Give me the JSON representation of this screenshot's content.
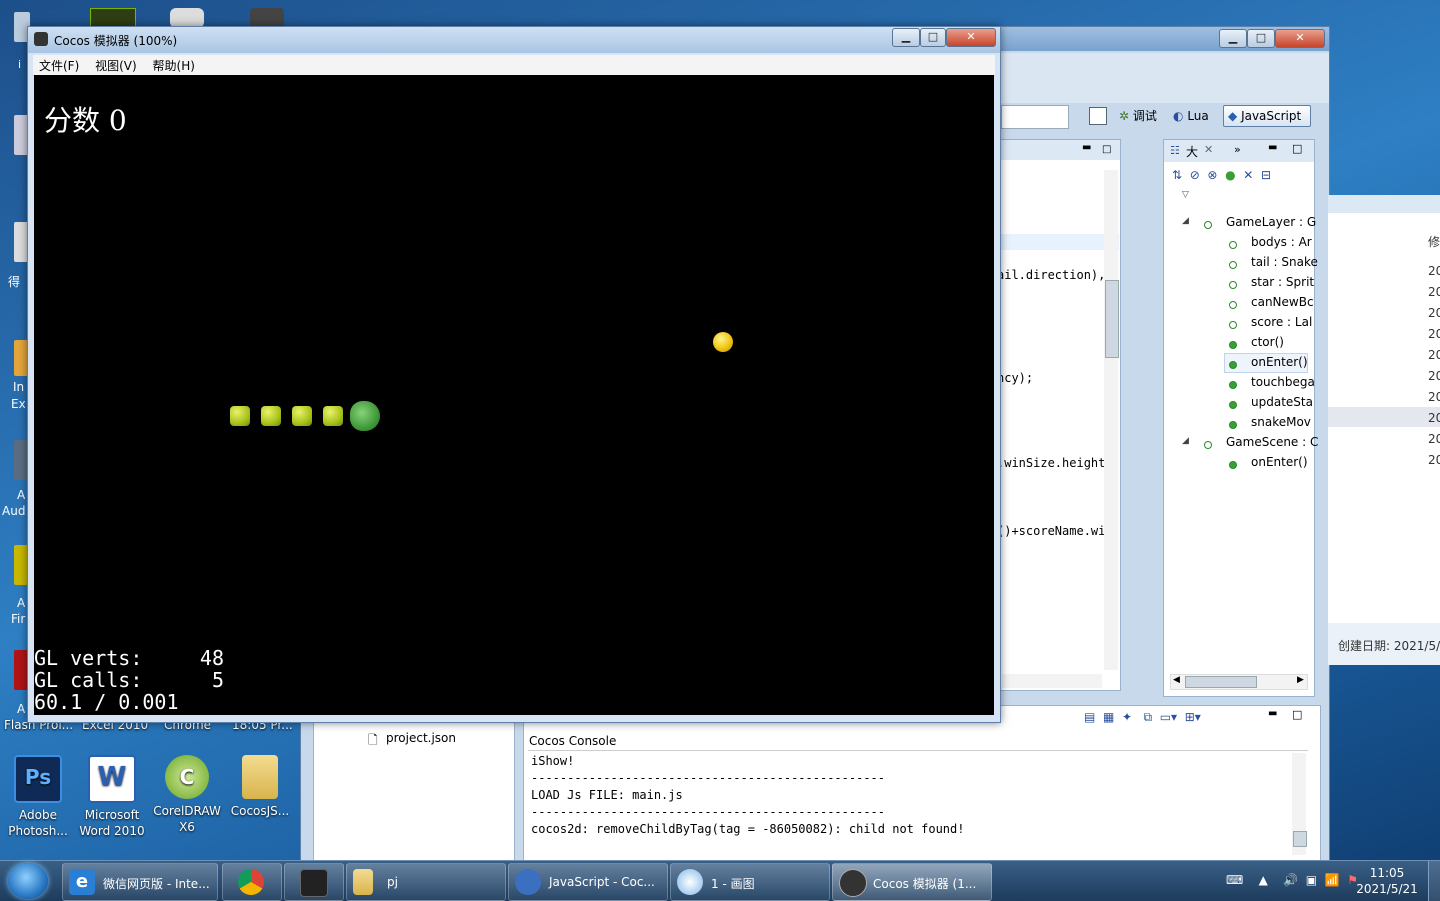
{
  "desktop": {
    "icons": [
      {
        "label": "Adobe Photosh...",
        "color": "#1f4f9c",
        "glyph": "Ps"
      },
      {
        "label": "Microsoft Word 2010",
        "color": "#2b5fb0",
        "glyph": "W"
      },
      {
        "label": "CorelDRAW X6",
        "color": "#6aa520",
        "glyph": "C"
      },
      {
        "label": "CocosJS...",
        "color": "#e2c56a",
        "glyph": ""
      }
    ],
    "partial_labels": [
      "Flash Prof...",
      "Excel 2010",
      "Chrome",
      "18:05 Pr..."
    ],
    "left_edge_labels": [
      "i",
      "得",
      "In",
      "Ex",
      "A",
      "Aud",
      "A",
      "Fir",
      "A"
    ]
  },
  "simulator": {
    "title": "Cocos 模拟器 (100%)",
    "menu": [
      "文件(F)",
      "视图(V)",
      "帮助(H)"
    ],
    "score_label": "分数 0",
    "stats": {
      "verts_label": "GL verts:",
      "verts_value": "48",
      "calls_label": "GL calls:",
      "calls_value": "5",
      "fps": "60.1 / 0.001"
    }
  },
  "ide": {
    "perspectives": {
      "debug": "调试",
      "lua": "Lua",
      "javascript": "JavaScript"
    },
    "code_fragments": [
      "ail.direction),",
      "ncy);",
      ".winSize.height",
      "()+scoreName.wi"
    ],
    "outline": {
      "tab_label": "大",
      "items": [
        {
          "label": "GameLayer : G",
          "level": 0
        },
        {
          "label": "bodys : Ar",
          "level": 1
        },
        {
          "label": "tail : Snake",
          "level": 1
        },
        {
          "label": "star : Sprit",
          "level": 1
        },
        {
          "label": "canNewBc",
          "level": 1
        },
        {
          "label": "score : Lal",
          "level": 1
        },
        {
          "label": "ctor()",
          "level": 1
        },
        {
          "label": "onEnter()",
          "level": 1
        },
        {
          "label": "touchbega",
          "level": 1
        },
        {
          "label": "updateSta",
          "level": 1
        },
        {
          "label": "snakeMov",
          "level": 1
        },
        {
          "label": "GameScene : C",
          "level": 0
        },
        {
          "label": "onEnter()",
          "level": 1
        }
      ]
    },
    "right_panel": {
      "header": "修",
      "rows": [
        "20",
        "20",
        "20",
        "20",
        "20",
        "20",
        "20",
        "20",
        "20",
        "20"
      ],
      "created": "创建日期: 2021/5/"
    },
    "project_file": "project.json",
    "console": {
      "title": "Cocos Console",
      "lines": [
        "iShow!",
        "-------------------------------------------------",
        "LOAD Js FILE: main.js",
        "-------------------------------------------------",
        "cocos2d: removeChildByTag(tag = -86050082): child not found!"
      ]
    }
  },
  "taskbar": {
    "items": [
      {
        "label": "微信网页版 - Inte...",
        "color": "#2a7fd4"
      },
      {
        "label": "",
        "color": "#db4437"
      },
      {
        "label": "",
        "color": "#222222"
      },
      {
        "label": "pj",
        "color": "#e8c766"
      },
      {
        "label": "JavaScript - Coc...",
        "color": "#3b6fc0"
      },
      {
        "label": "1 - 画图",
        "color": "#7fb7e8"
      },
      {
        "label": "Cocos 模拟器 (1...",
        "color": "#333333"
      }
    ],
    "clock_time": "11:05",
    "clock_date": "2021/5/21"
  }
}
